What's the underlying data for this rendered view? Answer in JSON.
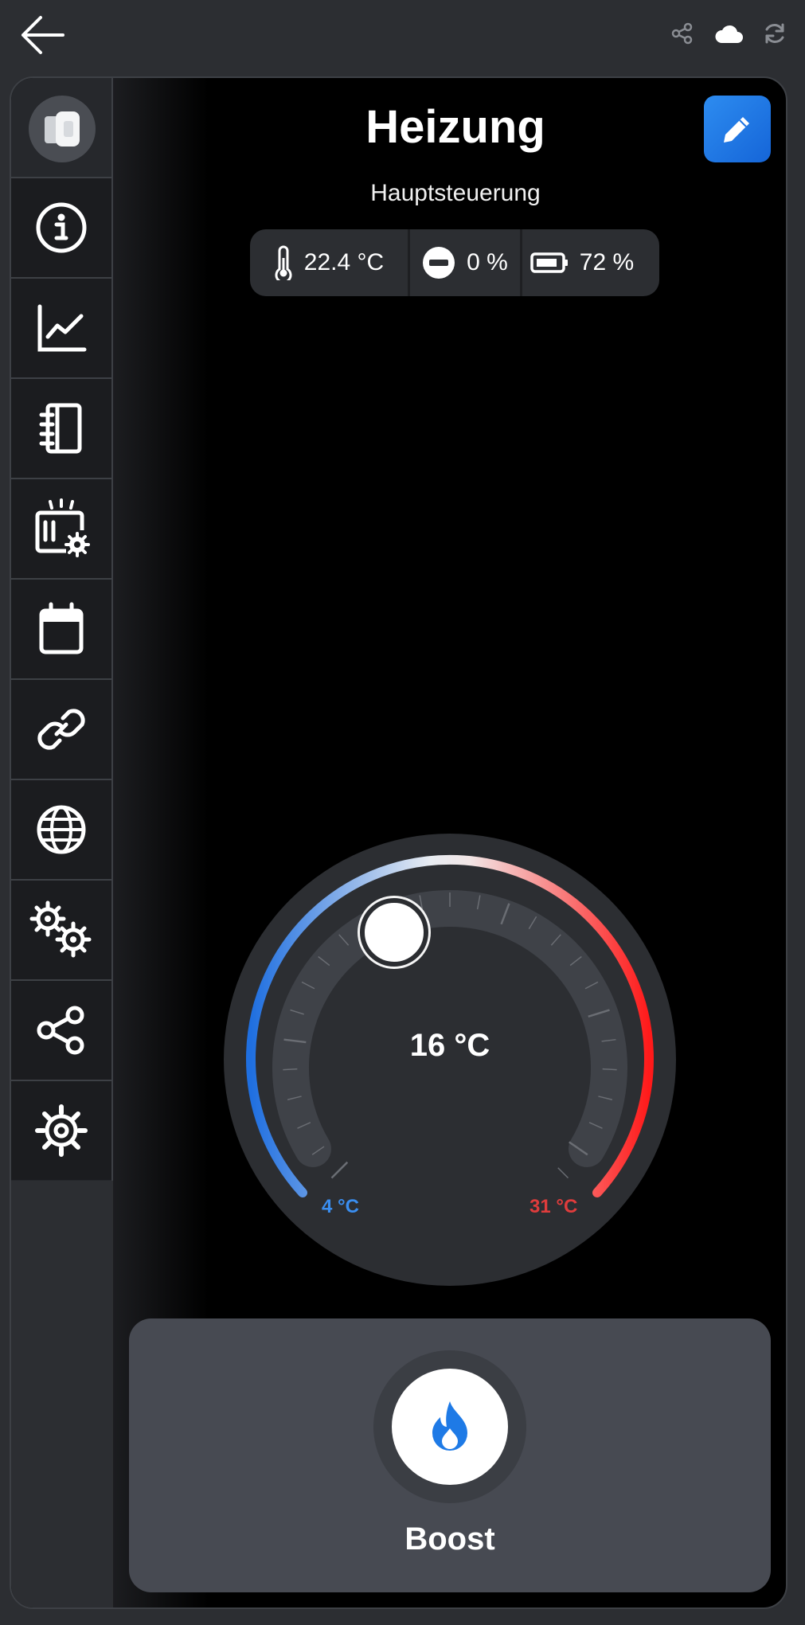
{
  "header": {
    "title": "Heizung",
    "subtitle": "Hauptsteuerung"
  },
  "status": {
    "temperature": "22.4 °C",
    "valve": "0 %",
    "battery": "72 %"
  },
  "sidebar": {
    "items": [
      {
        "name": "info",
        "icon": "info-icon"
      },
      {
        "name": "chart",
        "icon": "chart-icon"
      },
      {
        "name": "log",
        "icon": "notebook-icon"
      },
      {
        "name": "device-settings",
        "icon": "device-settings-icon"
      },
      {
        "name": "calendar",
        "icon": "calendar-icon"
      },
      {
        "name": "link",
        "icon": "link-icon"
      },
      {
        "name": "globe",
        "icon": "globe-icon"
      },
      {
        "name": "advanced-settings",
        "icon": "gears-icon"
      },
      {
        "name": "share",
        "icon": "share-icon"
      },
      {
        "name": "settings",
        "icon": "gear-icon"
      }
    ]
  },
  "dial": {
    "setpoint": "16 °C",
    "min_label": "4 °C",
    "max_label": "31 °C",
    "min": 4,
    "max": 31,
    "value": 16
  },
  "boost": {
    "label": "Boost"
  },
  "colors": {
    "accent": "#1e7ae6",
    "cold": "#1f6fe0",
    "hot": "#ff1a1a",
    "background": "#2c2e32"
  }
}
